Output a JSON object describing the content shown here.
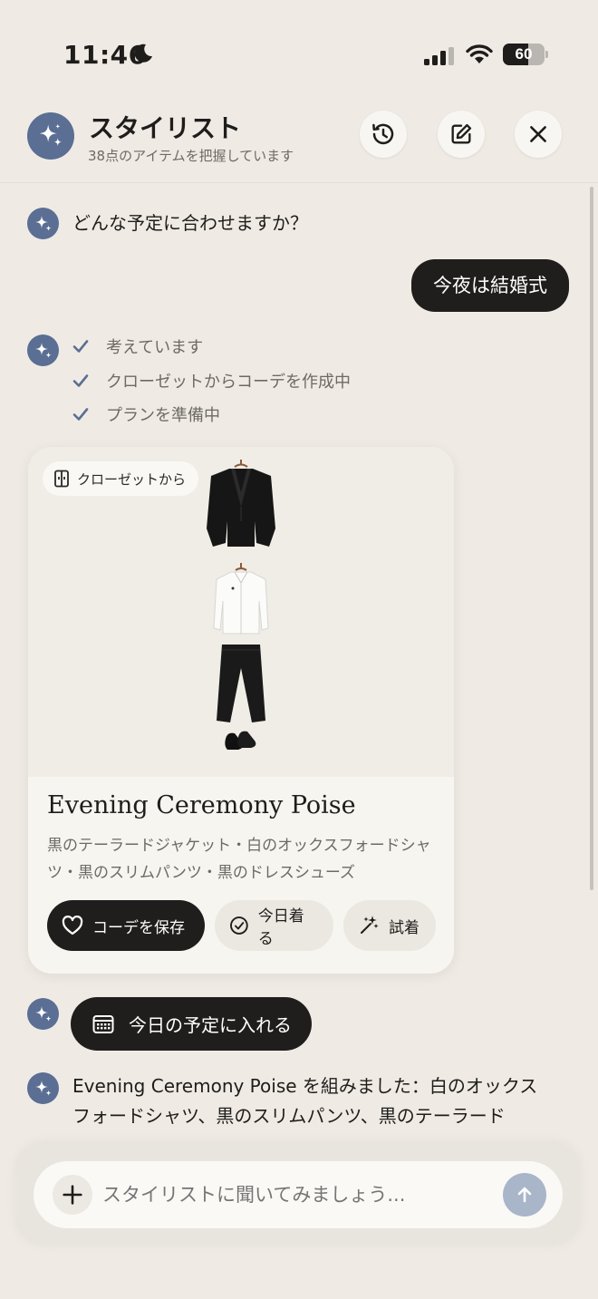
{
  "status_bar": {
    "time": "11:46",
    "battery": 60
  },
  "header": {
    "title": "スタイリスト",
    "subtitle": "38点のアイテムを把握しています"
  },
  "chat": {
    "bot_question": "どんな予定に合わせますか？",
    "user_reply": "今夜は結婚式",
    "steps": [
      "考えています",
      "クローゼットからコーデを作成中",
      "プランを準備中"
    ],
    "outfit_card": {
      "badge": "クローゼットから",
      "title": "Evening Ceremony Poise",
      "description": "黒のテーラードジャケット・白のオックスフォードシャツ・黒のスリムパンツ・黒のドレスシューズ",
      "save_label": "コーデを保存",
      "wear_today_label": "今日着る",
      "try_on_label": "試着"
    },
    "calendar_button": "今日の予定に入れる",
    "final_message": "Evening Ceremony Poise を組みました：白のオックスフォードシャツ、黒のスリムパンツ、黒のテーラード"
  },
  "input": {
    "placeholder": "スタイリストに聞いてみましょう..."
  },
  "colors": {
    "background": "#efebe4",
    "dark": "#1f1e1c",
    "accent_avatar": "#5b6e93",
    "checkmark": "#5b6e93",
    "send_disabled": "#a9b5c8"
  },
  "icons": [
    "moon-icon",
    "signal-icon",
    "wifi-icon",
    "battery-icon",
    "sparkles-icon",
    "history-icon",
    "edit-icon",
    "close-icon",
    "check-icon",
    "wardrobe-icon",
    "heart-icon",
    "check-circle-icon",
    "magic-wand-icon",
    "calendar-icon",
    "plus-icon",
    "arrow-up-icon"
  ]
}
